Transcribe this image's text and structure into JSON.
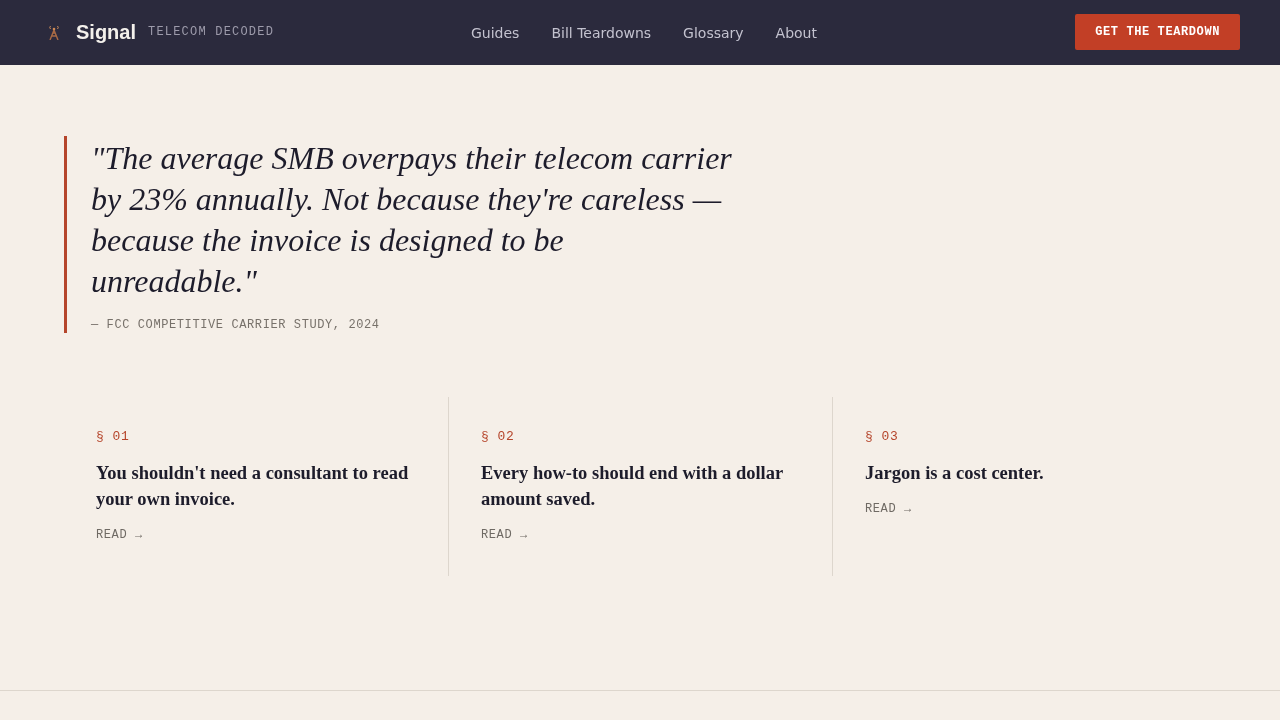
{
  "header": {
    "brand": "Signal",
    "tagline": "TELECOM DECODED",
    "nav": [
      "Guides",
      "Bill Teardowns",
      "Glossary",
      "About"
    ],
    "cta": "GET THE TEARDOWN"
  },
  "quote": {
    "text": "\"The average SMB overpays their telecom carrier by 23% annually. Not because they're careless — because the invoice is designed to be unreadable.\"",
    "citation": "— FCC COMPETITIVE CARRIER STUDY, 2024"
  },
  "principles": [
    {
      "number": "§ 01",
      "title": "You shouldn't need a consultant to read your own invoice.",
      "link": "READ →"
    },
    {
      "number": "§ 02",
      "title": "Every how-to should end with a dollar amount saved.",
      "link": "READ →"
    },
    {
      "number": "§ 03",
      "title": "Jargon is a cost center.",
      "link": "READ →"
    }
  ]
}
